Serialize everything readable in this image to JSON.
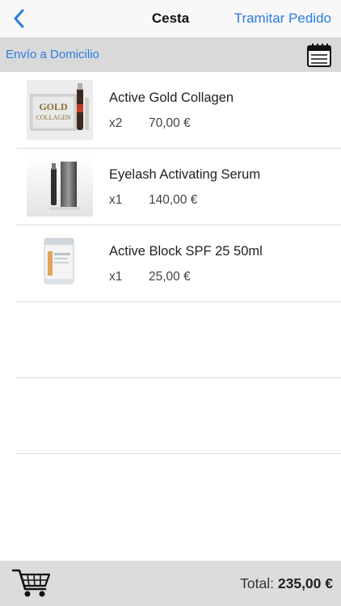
{
  "navbar": {
    "title": "Cesta",
    "action_label": "Tramitar Pedido",
    "back_icon": "chevron-left-icon"
  },
  "subbar": {
    "label": "Envío a Domicilio",
    "calendar_icon": "calendar-icon"
  },
  "items": [
    {
      "name": "Active Gold Collagen",
      "qty": "x2",
      "price": "70,00 €",
      "thumb_text_line1": "GOLD",
      "thumb_text_line2": "COLLAGEN"
    },
    {
      "name": "Eyelash Activating Serum",
      "qty": "x1",
      "price": "140,00 €"
    },
    {
      "name": " Active Block SPF 25 50ml",
      "qty": "x1",
      "price": "25,00 €"
    }
  ],
  "footer": {
    "total_label": "Total:",
    "total_value": "235,00 €",
    "cart_icon": "shopping-cart-icon"
  },
  "colors": {
    "accent": "#2a7de1",
    "subbar_bg": "#d9d9d9",
    "footer_bg": "#dcdcdc"
  }
}
